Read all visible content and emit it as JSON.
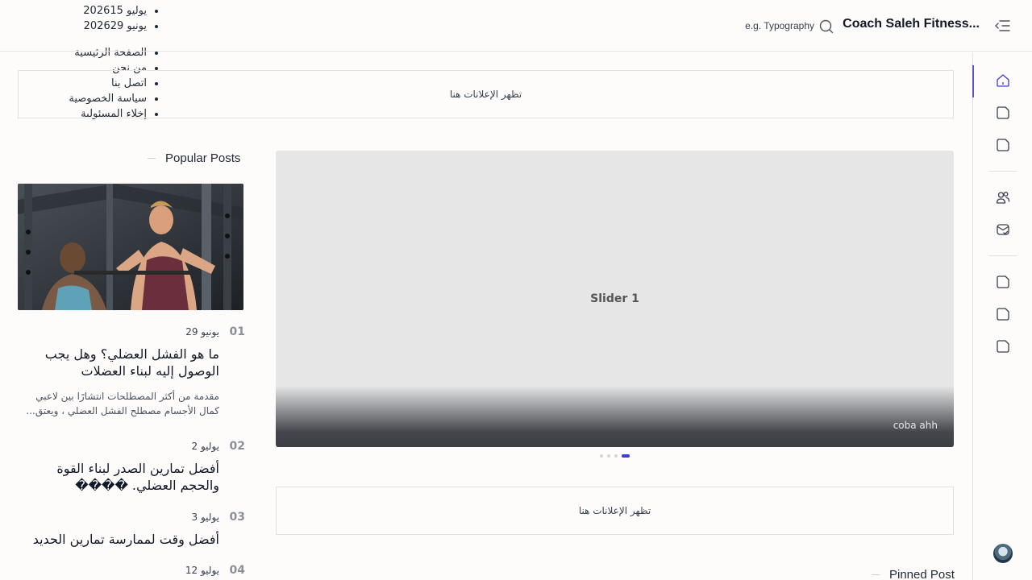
{
  "archive": [
    "يوليو 202615",
    "يونيو 202629"
  ],
  "footer_links": [
    "الصفحة الرئيسية",
    "من نحن",
    "اتصل بنا",
    "سياسة الخصوصية",
    "إخلاء المسئولية"
  ],
  "header": {
    "site_title": "Coach Saleh Fitness...",
    "search_placeholder": "e.g. Typography",
    "menu_icon": "menu-collapse-icon",
    "search_icon": "search-icon"
  },
  "ads": {
    "top_text": "تظهر الإعلانات هنا",
    "mid_text": "تظهر الإعلانات هنا"
  },
  "slider": {
    "slide_label": "Slider 1",
    "caption": "coba ahh",
    "dot_count": 4,
    "active_dot": 3
  },
  "popular": {
    "heading": "Popular Posts",
    "image_alt": "two men training in a gym squat rack",
    "posts": [
      {
        "num": "01",
        "date": "يونيو 29",
        "title": "ما هو الفشل العضلي؟ وهل يجب الوصول إليه لبناء العضلات",
        "excerpt": "مقدمة من أكثر المصطلحات انتشارًا بين لاعبي كمال الأجسام مصطلح الفشل العضلي ، ويعتق..."
      },
      {
        "num": "02",
        "date": "يوليو 2",
        "title": "أفضل تمارين الصدر لبناء القوة والحجم العضلي. ����"
      },
      {
        "num": "03",
        "date": "يوليو 3",
        "title": "أفضل وقت لممارسة تمارين الحديد"
      },
      {
        "num": "04",
        "date": "يوليو 12"
      }
    ]
  },
  "pinned": {
    "heading": "Pinned Post"
  },
  "rail": {
    "active_index": 0,
    "icons": [
      "home-icon",
      "note-icon",
      "note-icon",
      "users-icon",
      "mail-check-icon",
      "note-icon",
      "note-icon",
      "note-icon"
    ],
    "avatar": "site-logo-avatar"
  },
  "colors": {
    "accent": "#3f3bd1",
    "rail_active": "#5b52d6",
    "background": "#fdfcfb"
  }
}
